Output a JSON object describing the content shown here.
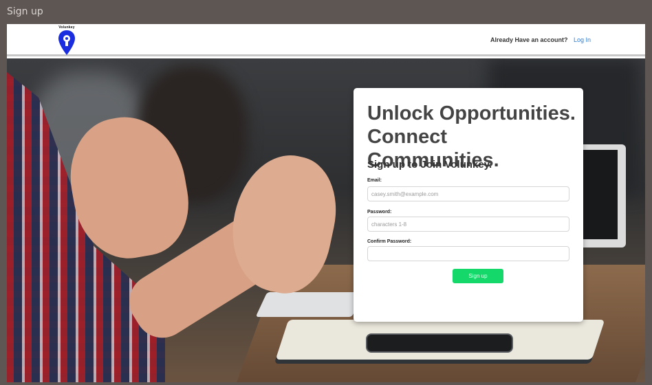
{
  "window": {
    "title": "Sign up"
  },
  "navbar": {
    "logo_text": "Volunkey",
    "account_question": "Already Have an account?",
    "login_link": "Log In"
  },
  "card": {
    "headline_line1": "Unlock Opportunities.",
    "headline_line2": "Connect Communities.",
    "subhead": "Sign up to Join Volunkey.",
    "email_label": "Email:",
    "email_placeholder": "casey.smith@example.com",
    "email_value": "",
    "password_label": "Password:",
    "password_placeholder": "characters 1-8",
    "password_value": "",
    "confirm_label": "Confirm Password:",
    "confirm_placeholder": "",
    "confirm_value": "",
    "submit_label": "Sign up"
  },
  "colors": {
    "window_bg": "#5e5653",
    "logo_blue": "#1a2ee0",
    "link_blue": "#2b7bd6",
    "button_green": "#14d96a"
  },
  "icons": {
    "logo": "location-pin-keyhole-icon"
  }
}
